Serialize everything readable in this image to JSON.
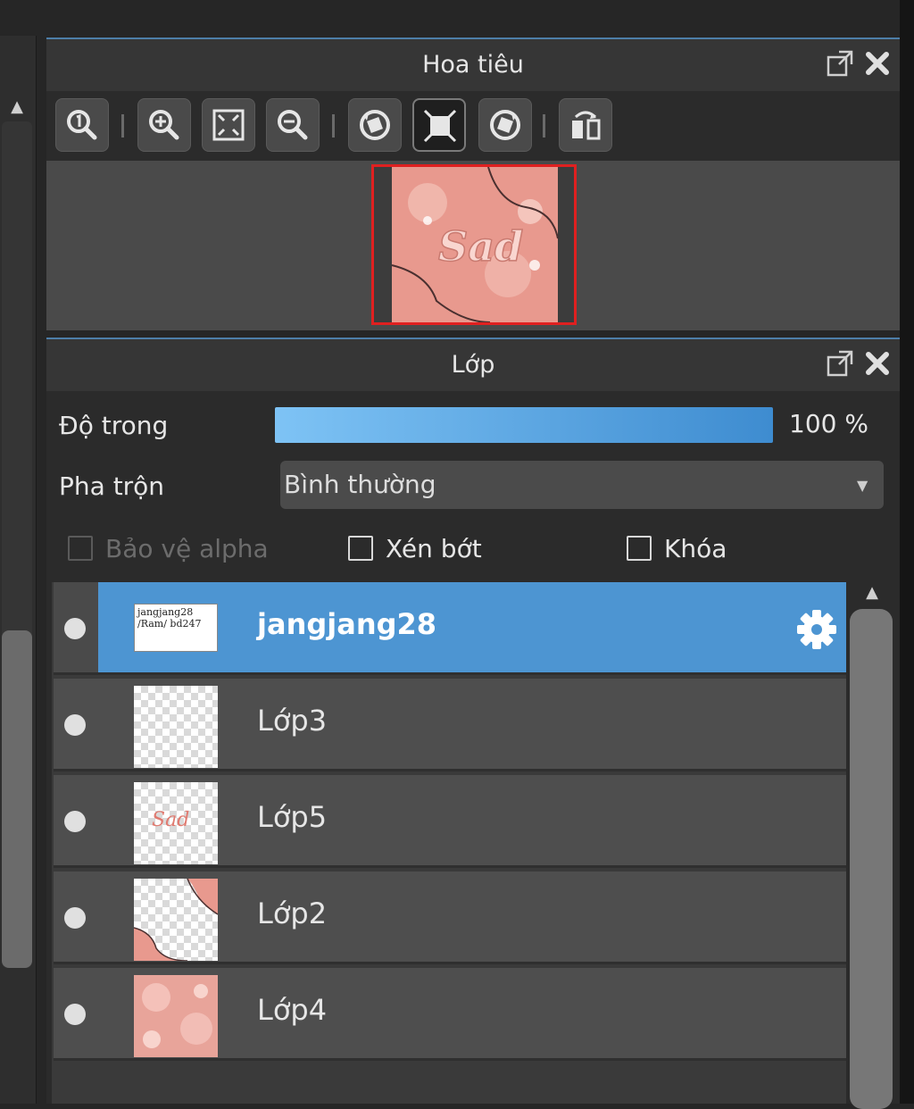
{
  "navigator": {
    "title": "Hoa tiêu",
    "toolbar_icons": [
      "zoom-actual-icon",
      "zoom-in-icon",
      "fit-screen-icon",
      "zoom-out-icon",
      "rotate-left-icon",
      "fit-frame-icon",
      "rotate-right-icon",
      "flip-horizontal-icon"
    ],
    "preview_text": "Sad",
    "preview_frame_color": "#e02020"
  },
  "layers_panel": {
    "title": "Lớp",
    "opacity_label": "Độ trong",
    "opacity_value": "100 %",
    "opacity_level": 1.0,
    "blend_label": "Pha trộn",
    "blend_value": "Bình thường",
    "protect_alpha_label": "Bảo vệ alpha",
    "clipping_label": "Xén bớt",
    "lock_label": "Khóa",
    "layers": [
      {
        "name": "jangjang28",
        "selected": true,
        "thumb_text": "jangjang28 /Ram/ bd247"
      },
      {
        "name": "Lớp3",
        "selected": false
      },
      {
        "name": "Lớp5",
        "selected": false,
        "thumb_text": "Sad"
      },
      {
        "name": "Lớp2",
        "selected": false
      },
      {
        "name": "Lớp4",
        "selected": false
      }
    ]
  },
  "colors": {
    "selected_layer": "#4d95d2",
    "opacity_bar_start": "#7ec3f5",
    "opacity_bar_end": "#3e8cd0",
    "panel_accent": "#4d7ea8"
  }
}
